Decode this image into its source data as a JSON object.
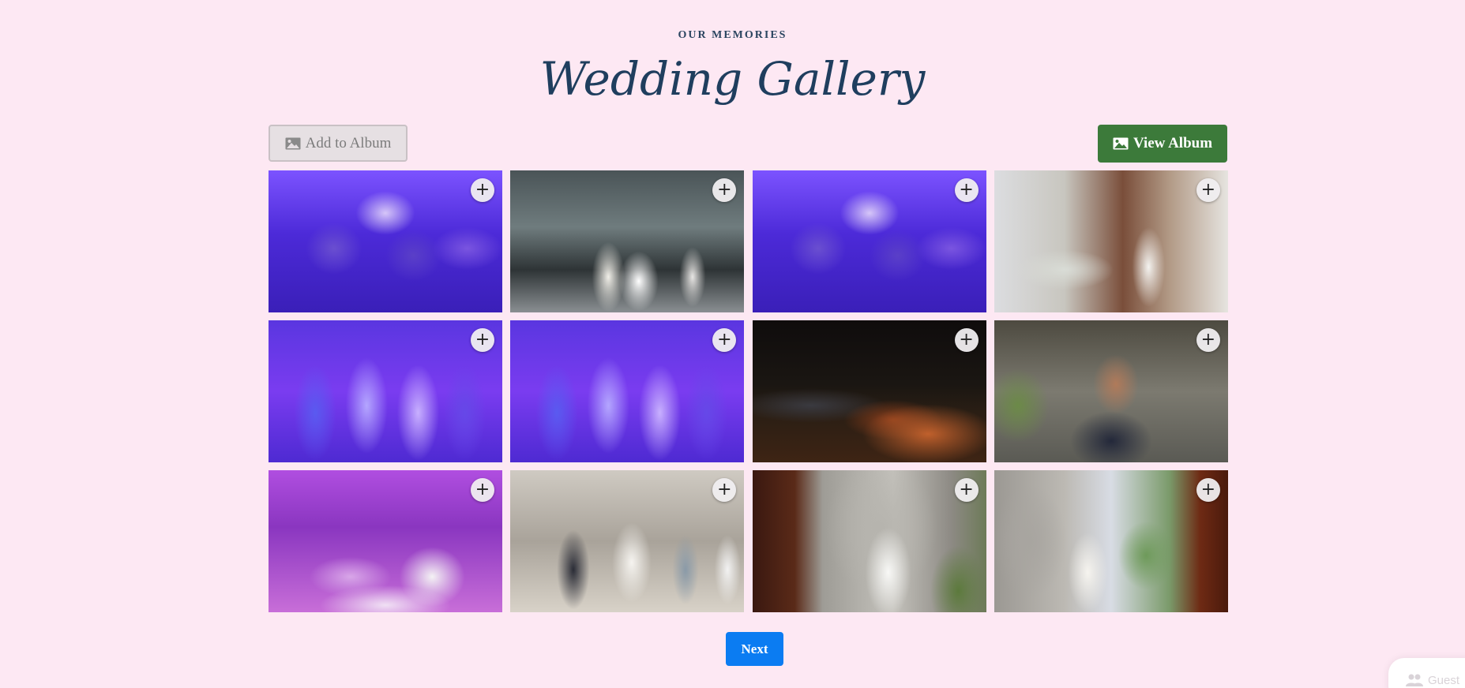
{
  "header": {
    "eyebrow": "OUR MEMORIES",
    "title": "Wedding Gallery"
  },
  "toolbar": {
    "add_label": "Add to Album",
    "add_icon": "image-icon",
    "view_label": "View Album",
    "view_icon": "image-icon",
    "view_color": "#3c7a3a"
  },
  "gallery": {
    "add_symbol": "+",
    "photos": [
      {
        "scene": "purple-lit group at table",
        "style": "p-purple"
      },
      {
        "scene": "couple by glass windows",
        "style": "p-couple"
      },
      {
        "scene": "purple-lit group at table",
        "style": "p-purple"
      },
      {
        "scene": "church aisle ceremony",
        "style": "p-church"
      },
      {
        "scene": "four guests posing purple light",
        "style": "p-group"
      },
      {
        "scene": "four guests posing purple light",
        "style": "p-group"
      },
      {
        "scene": "night city view with lights",
        "style": "p-night"
      },
      {
        "scene": "guest seated at reception",
        "style": "p-guest"
      },
      {
        "scene": "pink-lit reception tables",
        "style": "p-pink"
      },
      {
        "scene": "bride with guests indoors",
        "style": "p-bride"
      },
      {
        "scene": "bride by carved stone",
        "style": "p-stone1"
      },
      {
        "scene": "bride by carved stone window",
        "style": "p-stone2"
      }
    ]
  },
  "pagination": {
    "next_label": "Next",
    "next_color": "#0b7cf2"
  },
  "guest_widget": {
    "label": "Guest",
    "icon": "users-icon"
  },
  "colors": {
    "background": "#fde8f3",
    "title": "#1f3e5e"
  }
}
